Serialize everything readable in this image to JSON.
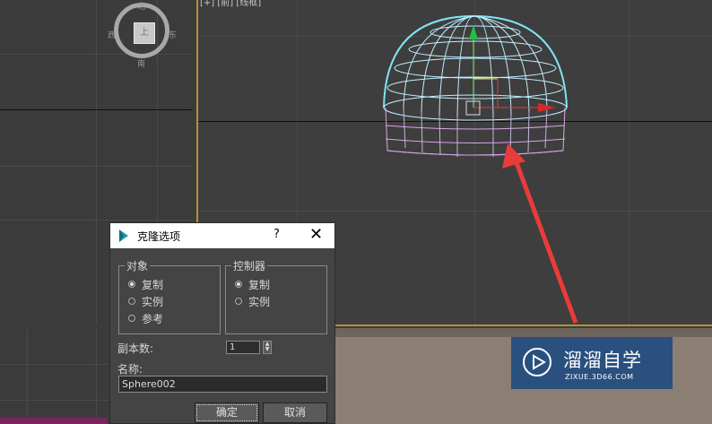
{
  "viewport_label": "[+] [前] [线框]",
  "viewcube": {
    "north": "北",
    "south": "南",
    "west": "西",
    "east": "东",
    "face": "上"
  },
  "dialog": {
    "title": "克隆选项",
    "help_glyph": "?",
    "close_glyph": "✕",
    "object_group": {
      "legend": "对象",
      "options": [
        {
          "label": "复制",
          "checked": true
        },
        {
          "label": "实例",
          "checked": false
        },
        {
          "label": "参考",
          "checked": false
        }
      ]
    },
    "controller_group": {
      "legend": "控制器",
      "options": [
        {
          "label": "复制",
          "checked": true
        },
        {
          "label": "实例",
          "checked": false
        }
      ]
    },
    "copies_label": "副本数:",
    "copies_value": "1",
    "name_label": "名称:",
    "name_value": "Sphere002",
    "ok_label": "确定",
    "cancel_label": "取消"
  },
  "watermark": {
    "brand": "溜溜自学",
    "url": "ZIXUE.3D66.COM",
    "color": "#29507e"
  },
  "colors": {
    "viewport_border": "#b8922f",
    "arrow": "#ea3b3b",
    "wire_top": "#7fe3f0",
    "wire_bottom": "#d9a6e6"
  }
}
